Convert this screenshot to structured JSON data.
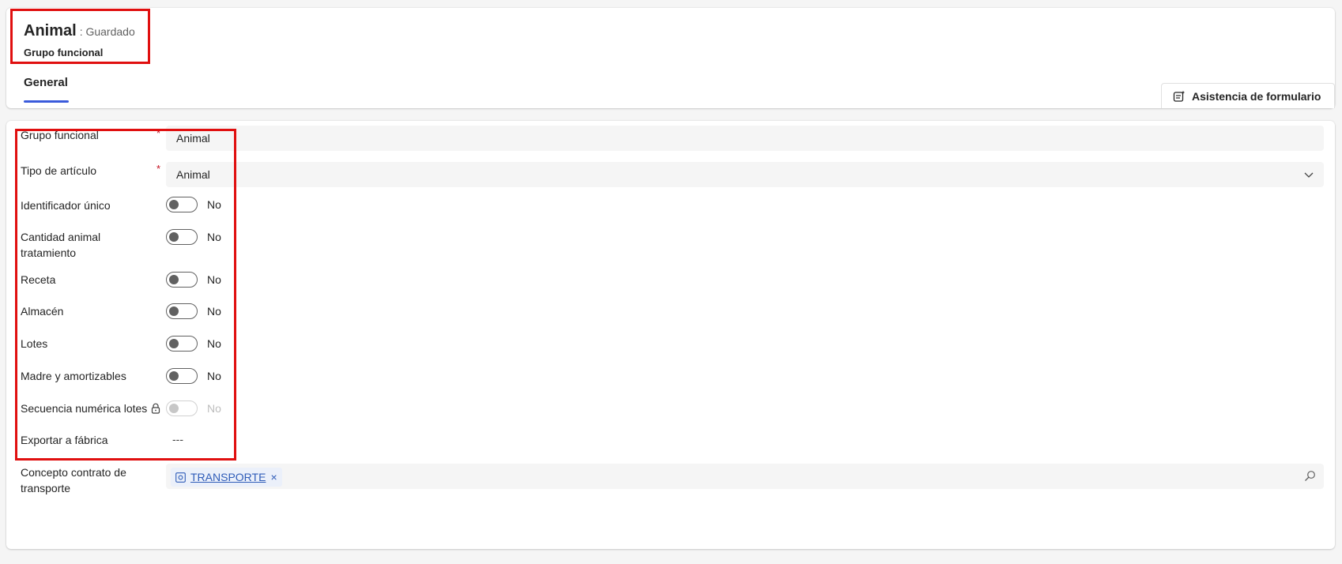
{
  "header": {
    "title": "Animal",
    "status": ": Guardado",
    "subtitle": "Grupo funcional",
    "tab": "General",
    "assist_button": "Asistencia de formulario"
  },
  "form": {
    "grupo_funcional": {
      "label": "Grupo funcional",
      "required": "*",
      "value": "Animal"
    },
    "tipo_articulo": {
      "label": "Tipo de artículo",
      "required": "*",
      "value": "Animal"
    },
    "toggles": [
      {
        "label": "Identificador único",
        "value": "No"
      },
      {
        "label": "Cantidad animal tratamiento",
        "value": "No"
      },
      {
        "label": "Receta",
        "value": "No"
      },
      {
        "label": "Almacén",
        "value": "No"
      },
      {
        "label": "Lotes",
        "value": "No"
      },
      {
        "label": "Madre y amortizables",
        "value": "No"
      },
      {
        "label": "Secuencia numérica lotes",
        "value": "No"
      }
    ],
    "exportar": {
      "label": "Exportar a fábrica",
      "value": "---"
    },
    "concepto": {
      "label": "Concepto contrato de transporte",
      "tag": "TRANSPORTE",
      "remove": "×"
    }
  },
  "icons": {
    "assist": "form-assist-icon",
    "chevron": "chevron-down-icon",
    "lock": "lock-icon",
    "tag": "entity-icon",
    "search": "search-icon"
  },
  "colors": {
    "highlight": "#e00f0f",
    "tab_underline": "#3b5bdb",
    "required": "#c50f1f",
    "link": "#2f5cb8"
  }
}
